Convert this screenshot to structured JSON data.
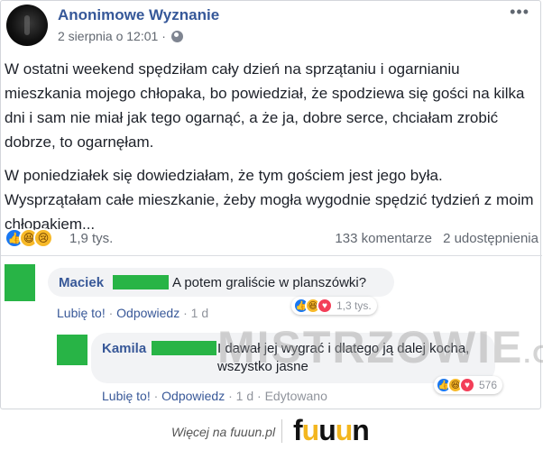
{
  "post": {
    "author": "Anonimowe Wyznanie",
    "date": "2 sierpnia o 12:01 ·",
    "menu": "•••",
    "paragraphs": [
      "W ostatni weekend spędziłam cały dzień na sprzątaniu i ogarnianiu mieszkania mojego chłopaka, bo powiedział, że spodziewa się gości na kilka dni i sam nie miał jak tego ogarnąć, a że ja, dobre serce, chciałam zrobić dobrze, to ogarnęłam.",
      "W poniedziałek się dowiedziałam, że tym gościem jest jego była. Wysprzątałam całe mieszkanie, żeby mogła wygodnie spędzić tydzień z moim chłopakiem..."
    ],
    "reactions_count": "1,9 tys.",
    "comments_count": "133 komentarze",
    "shares_count": "2 udostępnienia"
  },
  "comments": [
    {
      "name": "Maciek",
      "text": "A potem graliście w planszówki?",
      "like": "Lubię to!",
      "reply": "Odpowiedz",
      "time": "1 d",
      "reactions": "1,3 tys."
    },
    {
      "name": "Kamila",
      "text": "I dawał jej wygrać i dlatego ją dalej kocha, wszystko jasne",
      "like": "Lubię to!",
      "reply": "Odpowiedz",
      "time": "1 d",
      "edited": "Edytowano",
      "reactions": "576"
    }
  ],
  "watermark": {
    "main": "MISTRZOWIE",
    "suffix": ".ORG"
  },
  "footer": {
    "tagline": "Więcej na fuuun.pl",
    "logo": [
      "f",
      "u",
      "u",
      "u",
      "n"
    ]
  },
  "colors": {
    "link": "#385898",
    "author": "#365899",
    "censor": "#28b446",
    "like": "#1877f2",
    "love": "#f33e58",
    "haha": "#f7b928"
  },
  "icons": [
    "globe-icon",
    "like-reaction-icon",
    "haha-reaction-icon",
    "sad-reaction-icon",
    "love-reaction-icon"
  ]
}
